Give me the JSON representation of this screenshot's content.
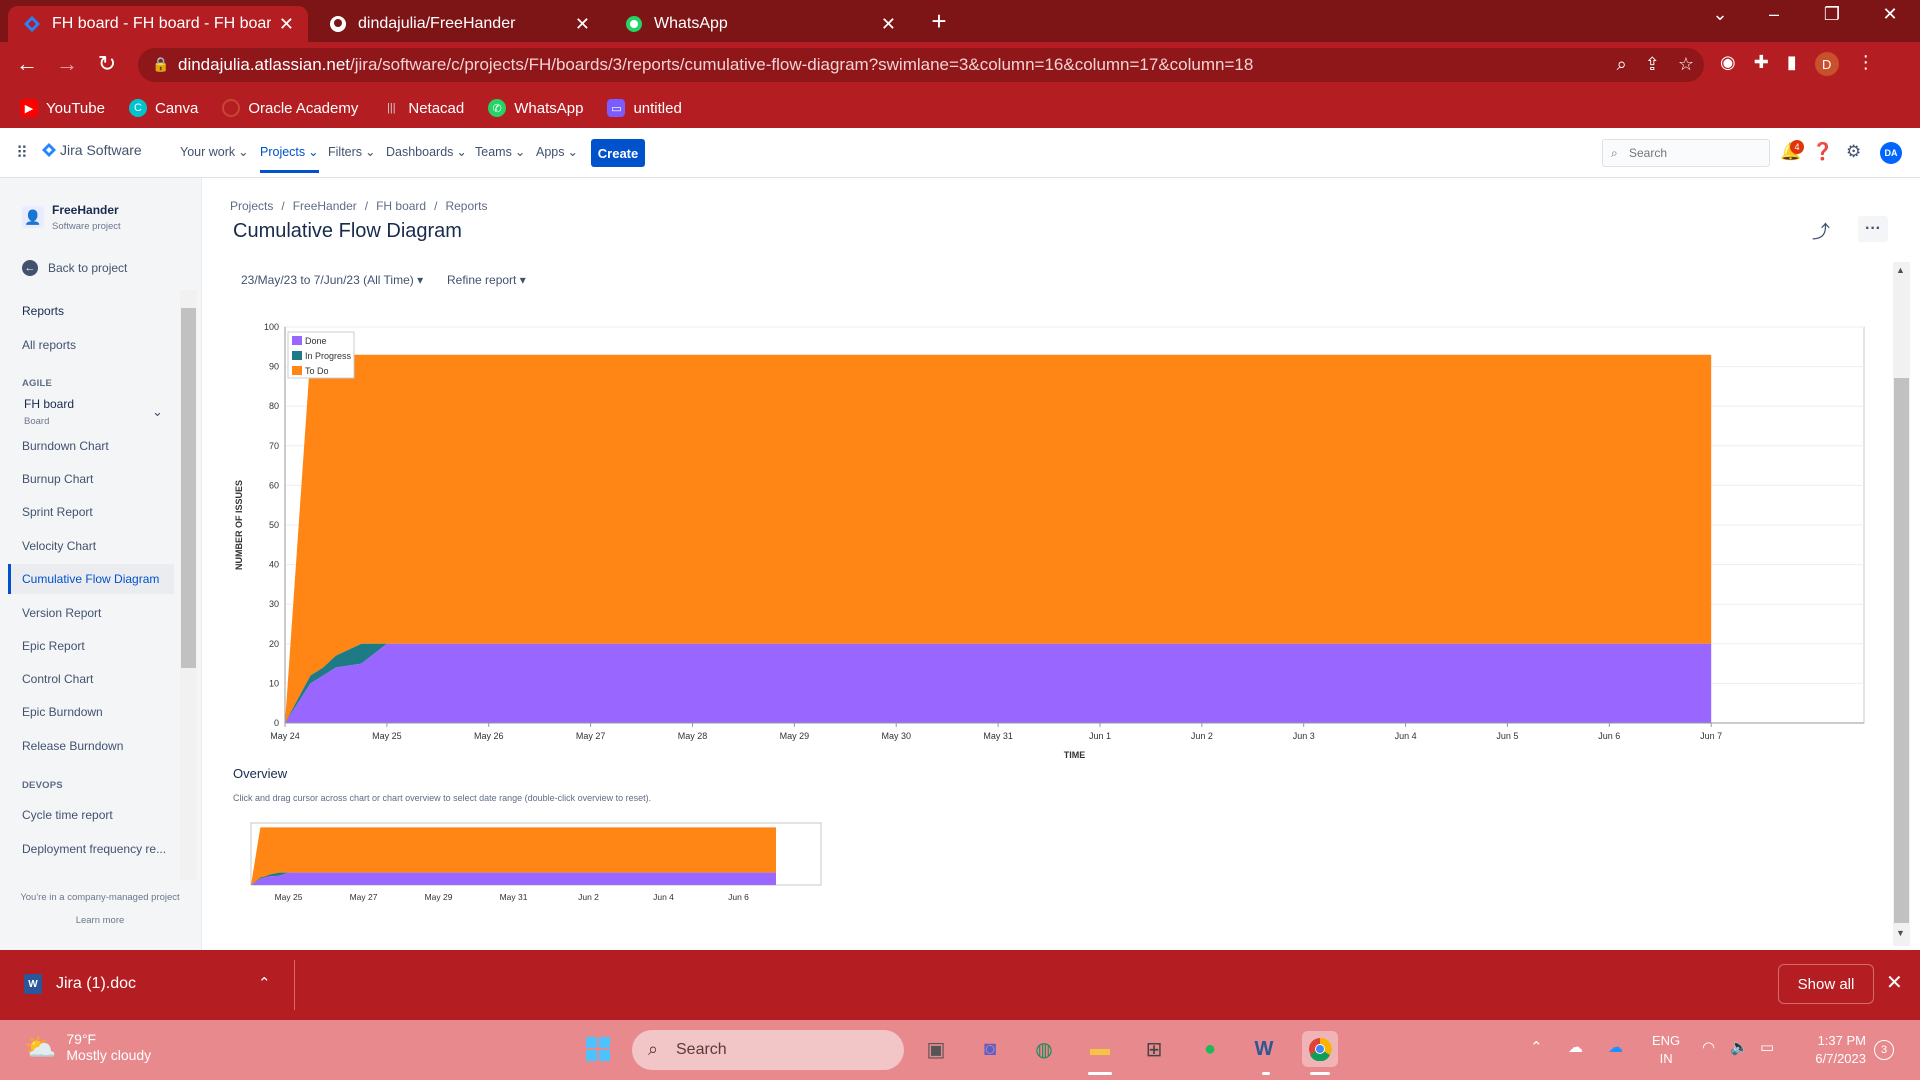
{
  "browser": {
    "tabs": [
      {
        "title": "FH board - FH board - FH board",
        "icon": "jira-icon",
        "active": true
      },
      {
        "title": "dindajulia/FreeHander",
        "icon": "github-icon",
        "active": false
      },
      {
        "title": "WhatsApp",
        "icon": "whatsapp-icon",
        "active": false
      }
    ],
    "url_domain": "dindajulia.atlassian.net",
    "url_path": "/jira/software/c/projects/FH/boards/3/reports/cumulative-flow-diagram?swimlane=3&column=16&column=17&column=18",
    "profile_initial": "D",
    "bookmarks": [
      {
        "label": "YouTube",
        "icon": "youtube-icon",
        "color": "#ff0000"
      },
      {
        "label": "Canva",
        "icon": "canva-icon",
        "color": "#00c4cc"
      },
      {
        "label": "Oracle Academy",
        "icon": "oracle-icon",
        "color": "#c74634"
      },
      {
        "label": "Netacad",
        "icon": "cisco-icon",
        "color": "#8a8a8a"
      },
      {
        "label": "WhatsApp",
        "icon": "whatsapp-icon",
        "color": "#25d366"
      },
      {
        "label": "untitled",
        "icon": "bookmark-icon",
        "color": "#7b5cff"
      }
    ]
  },
  "jira": {
    "product": "Jira Software",
    "nav": [
      "Your work",
      "Projects",
      "Filters",
      "Dashboards",
      "Teams",
      "Apps"
    ],
    "create_label": "Create",
    "search_placeholder": "Search",
    "notification_count": "4",
    "user_initials": "DA"
  },
  "sidebar": {
    "project_name": "FreeHander",
    "project_type": "Software project",
    "back_label": "Back to project",
    "reports_label": "Reports",
    "all_reports": "All reports",
    "agile_header": "AGILE",
    "board_name": "FH board",
    "board_type": "Board",
    "agile_items": [
      "Burndown Chart",
      "Burnup Chart",
      "Sprint Report",
      "Velocity Chart",
      "Cumulative Flow Diagram",
      "Version Report",
      "Epic Report",
      "Control Chart",
      "Epic Burndown",
      "Release Burndown"
    ],
    "active_item": "Cumulative Flow Diagram",
    "devops_header": "DEVOPS",
    "devops_items": [
      "Cycle time report",
      "Deployment frequency re..."
    ],
    "footer_text": "You're in a company-managed project",
    "learn_more": "Learn more"
  },
  "main": {
    "breadcrumbs": [
      "Projects",
      "FreeHander",
      "FH board",
      "Reports"
    ],
    "title": "Cumulative Flow Diagram",
    "date_filter": "23/May/23 to 7/Jun/23 (All Time)",
    "refine_label": "Refine report",
    "overview_title": "Overview",
    "overview_help": "Click and drag cursor across chart or chart overview to select date range (double-click overview to reset)."
  },
  "chart_data": {
    "type": "area",
    "stacked": true,
    "xlabel": "TIME",
    "ylabel": "NUMBER OF ISSUES",
    "ylim": [
      0,
      100
    ],
    "yticks": [
      0,
      10,
      20,
      30,
      40,
      50,
      60,
      70,
      80,
      90,
      100
    ],
    "x_tick_labels": [
      "May 24",
      "May 25",
      "May 26",
      "May 27",
      "May 28",
      "May 29",
      "May 30",
      "May 31",
      "Jun 1",
      "Jun 2",
      "Jun 3",
      "Jun 4",
      "Jun 5",
      "Jun 6",
      "Jun 7"
    ],
    "overview_tick_labels": [
      "May 25",
      "May 27",
      "May 29",
      "May 31",
      "Jun 2",
      "Jun 4",
      "Jun 6"
    ],
    "legend_position": "top-left",
    "x": [
      "May 24 00:00",
      "May 24 06:00",
      "May 24 09:00",
      "May 24 12:00",
      "May 24 18:00",
      "May 25 00:00",
      "Jun 7"
    ],
    "series": [
      {
        "name": "Done",
        "color": "#9966ff",
        "values": [
          0,
          10,
          12,
          14,
          15,
          20,
          20
        ]
      },
      {
        "name": "In Progress",
        "color": "#1e7b85",
        "values": [
          0,
          2,
          2,
          3,
          5,
          0,
          0
        ]
      },
      {
        "name": "To Do",
        "color": "#ff8514",
        "values": [
          0,
          81,
          79,
          76,
          73,
          73,
          73
        ]
      }
    ]
  },
  "downloads": {
    "file_name": "Jira (1).doc",
    "show_all": "Show all"
  },
  "taskbar": {
    "temperature": "79°F",
    "weather": "Mostly cloudy",
    "search_label": "Search",
    "lang_top": "ENG",
    "lang_bottom": "IN",
    "time": "1:37 PM",
    "date": "6/7/2023",
    "notification_count": "3"
  }
}
